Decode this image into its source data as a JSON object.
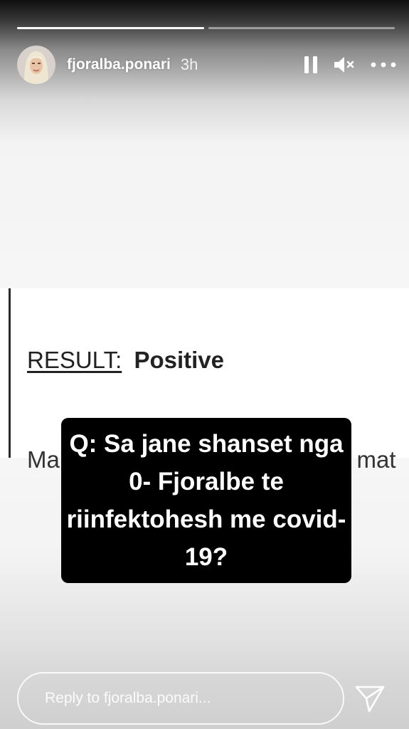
{
  "story": {
    "progress": [
      1,
      0
    ],
    "username": "fjoralba.ponari",
    "time_ago": "3h"
  },
  "icons": {
    "pause": "pause-icon",
    "mute": "speaker-muted-icon",
    "more": "more-horizontal-icon",
    "send": "send-icon"
  },
  "content": {
    "result_label": "RESULT:",
    "result_value": "Positive",
    "cut_left": "Ma",
    "cut_right": "l mat",
    "question": "Q: Sa jane shanset nga 0- Fjoralbe te riinfektohesh me covid-19?"
  },
  "reply": {
    "placeholder": "Reply to fjoralba.ponari..."
  }
}
